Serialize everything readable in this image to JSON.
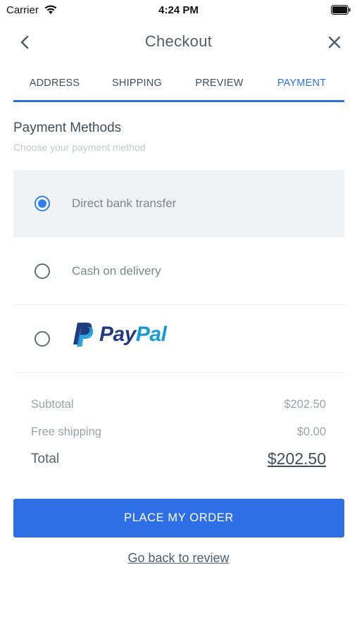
{
  "status_bar": {
    "carrier": "Carrier",
    "time": "4:24 PM"
  },
  "nav": {
    "title": "Checkout",
    "back_icon": "chevron-left-icon",
    "close_icon": "close-icon"
  },
  "tabs": [
    {
      "label": "ADDRESS",
      "active": false
    },
    {
      "label": "SHIPPING",
      "active": false
    },
    {
      "label": "PREVIEW",
      "active": false
    },
    {
      "label": "PAYMENT",
      "active": true
    }
  ],
  "payment": {
    "title": "Payment Methods",
    "subtitle": "Choose your payment method",
    "methods": [
      {
        "label": "Direct bank transfer",
        "selected": true
      },
      {
        "label": "Cash on delivery",
        "selected": false
      },
      {
        "label": "PayPal",
        "logo_pay": "Pay",
        "logo_pal": "Pal",
        "selected": false
      }
    ]
  },
  "totals": {
    "subtotal_label": "Subtotal",
    "subtotal_value": "$202.50",
    "shipping_label": "Free shipping",
    "shipping_value": "$0.00",
    "total_label": "Total",
    "total_value": "$202.50"
  },
  "actions": {
    "place_order": "PLACE MY ORDER",
    "back_link": "Go back to review"
  },
  "colors": {
    "accent": "#2f6fe6",
    "radio_selected": "#2f80ed",
    "paypal_dark": "#253b80",
    "paypal_light": "#179bd7",
    "selected_row_bg": "#f1f2f4"
  }
}
